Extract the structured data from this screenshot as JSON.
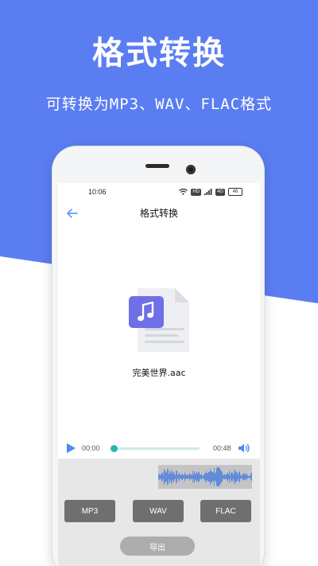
{
  "promo": {
    "title": "格式转换",
    "subtitle": "可转换为MP3、WAV、FLAC格式"
  },
  "colors": {
    "accent_blue": "#5a7df2",
    "progress_teal": "#2bb6ae",
    "file_icon_purple": "#6f6fe8",
    "play_blue": "#4a8cf0"
  },
  "status_bar": {
    "time": "10:06",
    "hd_label": "HD",
    "signal_label": "4G",
    "battery": "46"
  },
  "nav": {
    "back_icon": "arrow-left-icon",
    "title": "格式转换"
  },
  "file": {
    "icon": "music-file-icon",
    "name": "完美世界.aac"
  },
  "player": {
    "current_time": "00:00",
    "total_time": "00:48",
    "progress_fraction": 0.0,
    "play_icon": "play-icon",
    "volume_icon": "volume-icon"
  },
  "formats": {
    "mp3_label": "MP3",
    "wav_label": "WAV",
    "flac_label": "FLAC"
  },
  "export": {
    "label": "导出"
  }
}
